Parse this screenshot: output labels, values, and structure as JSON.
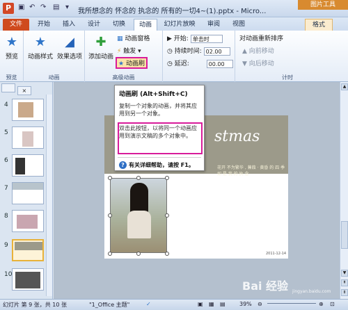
{
  "titlebar": {
    "app_icon": "P",
    "title": "我所想念的 怀念的 执念的 所有的一切4~(1).pptx - Micro...",
    "context_group": "图片工具",
    "qat": [
      "save-icon",
      "undo-icon",
      "redo-icon",
      "folder-icon"
    ]
  },
  "tabs": {
    "file": "文件",
    "items": [
      "开始",
      "插入",
      "设计",
      "切换",
      "动画",
      "幻灯片放映",
      "审阅",
      "视图"
    ],
    "format": "格式"
  },
  "ribbon": {
    "preview": {
      "label": "预览",
      "group": "预览"
    },
    "animation": {
      "style_label": "动画样式",
      "effect_label": "效果选项",
      "group": "动画"
    },
    "advanced": {
      "add_label": "添加动画",
      "pane_label": "动画窗格",
      "trigger_label": "触发",
      "painter_label": "动画刷",
      "group": "高级动画"
    },
    "timing": {
      "start_label": "开始:",
      "start_value": "单击时",
      "duration_label": "持续时间:",
      "duration_value": "02.00",
      "delay_label": "延迟:",
      "delay_value": "00.00",
      "group": "计时"
    },
    "reorder": {
      "title": "对动画重新排序",
      "earlier": "向前移动",
      "later": "向后移动"
    }
  },
  "left_panel": {
    "tabs": [
      "",
      "×"
    ],
    "slides": [
      {
        "num": "4",
        "selected": false
      },
      {
        "num": "5",
        "selected": false
      },
      {
        "num": "6",
        "selected": false
      },
      {
        "num": "7",
        "selected": false
      },
      {
        "num": "8",
        "selected": false
      },
      {
        "num": "9",
        "selected": true
      },
      {
        "num": "10",
        "selected": false
      }
    ]
  },
  "tooltip": {
    "title": "动画刷 (Alt+Shift+C)",
    "desc": "复制一个对象的动画，并将其应用到另一个对象。",
    "desc2": "双击此按钮，以将同一个动画应用到演示文稿的多个对象中。",
    "help": "有关详细帮助，请按 F1。"
  },
  "slide": {
    "title_art": "stmas",
    "banner_text": "花开 不为繁华 , 蒹葭 · 黄昏 的 四 季 如 是 我 的 执 念",
    "date": "2011-12-14"
  },
  "statusbar": {
    "slide_info": "幻灯片 第 9 张，共 10 张",
    "theme": "\"1_Office 主题\"",
    "zoom": "39%"
  },
  "watermark": {
    "text": "Bai 经验",
    "sub": "jingyan.baidu.com"
  }
}
